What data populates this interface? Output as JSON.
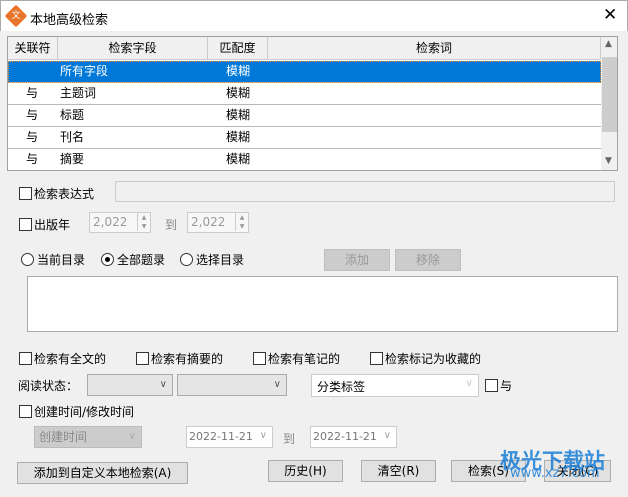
{
  "window": {
    "title": "本地高级检索",
    "close": "✕"
  },
  "table": {
    "headers": [
      "关联符",
      "检索字段",
      "匹配度",
      "检索词"
    ],
    "rows": [
      {
        "op": "",
        "field": "所有字段",
        "match": "模糊",
        "term": ""
      },
      {
        "op": "与",
        "field": "主题词",
        "match": "模糊",
        "term": ""
      },
      {
        "op": "与",
        "field": "标题",
        "match": "模糊",
        "term": ""
      },
      {
        "op": "与",
        "field": "刊名",
        "match": "模糊",
        "term": ""
      },
      {
        "op": "与",
        "field": "摘要",
        "match": "模糊",
        "term": ""
      }
    ]
  },
  "expression": {
    "label": "检索表达式",
    "value": ""
  },
  "year": {
    "label": "出版年",
    "from": "2,022",
    "to_label": "到",
    "to": "2,022"
  },
  "scope": {
    "options": [
      "当前目录",
      "全部题录",
      "选择目录"
    ],
    "selected": "全部题录",
    "add": "添加",
    "remove": "移除"
  },
  "filters": [
    "检索有全文的",
    "检索有摘要的",
    "检索有笔记的",
    "检索标记为收藏的"
  ],
  "read_status": {
    "label": "阅读状态：",
    "select1": "",
    "select2": "",
    "tags": "分类标签",
    "and_label": "与"
  },
  "time": {
    "label": "创建时间/修改时间",
    "type": "创建时间",
    "from": "2022-11-21",
    "to_label": "到",
    "to": "2022-11-21"
  },
  "buttons": {
    "add_custom": "添加到自定义本地检索(A)",
    "history": "历史(H)",
    "clear": "清空(R)",
    "search": "检索(S)",
    "close": "关闭(C)"
  },
  "watermark": {
    "name": "极光下载站",
    "url": "www.xz7.com"
  }
}
